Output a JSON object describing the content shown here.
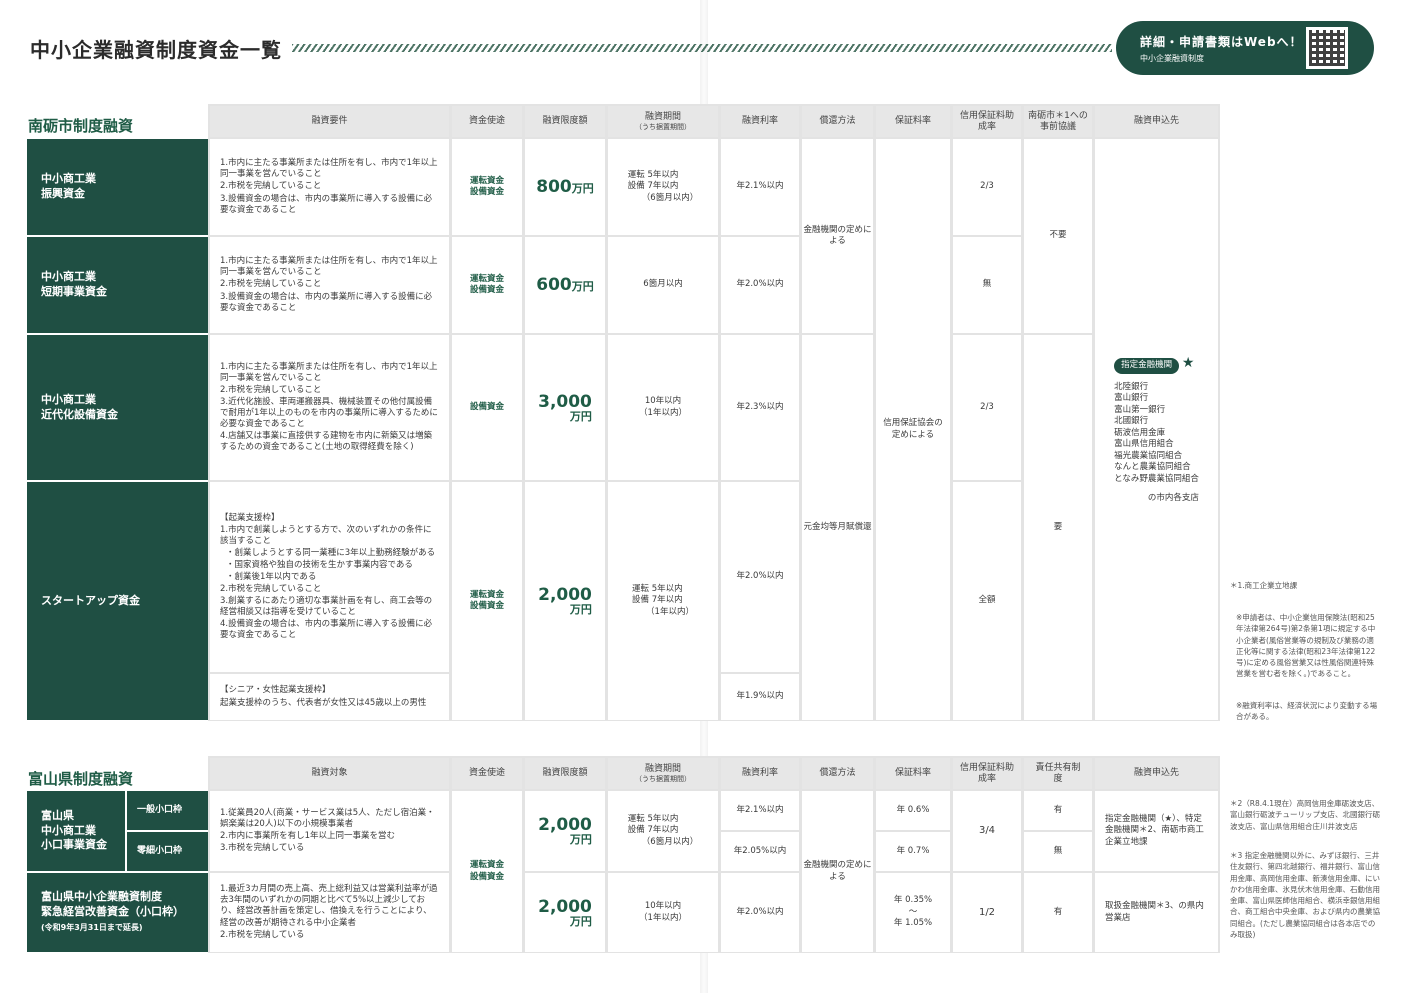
{
  "page_title": "中小企業融資制度資金一覧",
  "web": {
    "title": "詳細・申請書類はWebへ！",
    "subtitle": "中小企業融資制度"
  },
  "section1": {
    "title": "南砺市制度融資",
    "headers": {
      "req": "融資要件",
      "use": "資金使途",
      "limit": "融資限度額",
      "period": "融資期間",
      "period_sub": "（うち据置期間）",
      "rate": "融資利率",
      "repay": "償還方法",
      "fee": "保証料率",
      "subsidy": "信用保証料助成率",
      "consult": "南砺市＊1への事前協議",
      "apply": "融資申込先"
    },
    "rows": [
      {
        "name1": "中小商工業",
        "name2": "振興資金",
        "req": [
          "1.市内に主たる事業所または住所を有し、市内で1年以上同一事業を営んでいること",
          "2.市税を完納していること",
          "3.設備資金の場合は、市内の事業所に導入する設備に必要な資金であること"
        ],
        "use1": "運転資金",
        "use2": "設備資金",
        "limit_num": "800",
        "limit_unit": "万円",
        "period1": "運転 5年以内",
        "period2": "設備 7年以内",
        "period3": "（6箇月以内）",
        "rate": "年2.1%以内",
        "subsidy": "2/3"
      },
      {
        "name1": "中小商工業",
        "name2": "短期事業資金",
        "req": [
          "1.市内に主たる事業所または住所を有し、市内で1年以上同一事業を営んでいること",
          "2.市税を完納していること",
          "3.設備資金の場合は、市内の事業所に導入する設備に必要な資金であること"
        ],
        "use1": "運転資金",
        "use2": "設備資金",
        "limit_num": "600",
        "limit_unit": "万円",
        "period1": "6箇月以内",
        "rate": "年2.0%以内",
        "subsidy": "無"
      },
      {
        "name1": "中小商工業",
        "name2": "近代化設備資金",
        "req": [
          "1.市内に主たる事業所または住所を有し、市内で1年以上同一事業を営んでいること",
          "2.市税を完納していること",
          "3.近代化施設、車両運搬器具、機械装置その他付属設備で耐用が1年以上のものを市内の事業所に導入するために必要な資金であること",
          "4.店舗又は事業に直接供する建物を市内に新築又は増築するための資金であること(土地の取得経費を除く)"
        ],
        "use1": "設備資金",
        "limit_num": "3,000",
        "limit_unit": "万円",
        "period1": "10年以内",
        "period2": "（1年以内）",
        "rate": "年2.3%以内",
        "subsidy": "2/3"
      },
      {
        "name1": "スタートアップ資金",
        "req": [
          "【起業支援枠】",
          "1.市内で創業しようとする方で、次のいずれかの条件に該当すること",
          "・創業しようとする同一業種に3年以上勤務経験がある",
          "・国家資格や独自の技術を生かす事業内容である",
          "・創業後1年以内である",
          "2.市税を完納していること",
          "3.創業するにあたり適切な事業計画を有し、商工会等の経営相談又は指導を受けていること",
          "4.設備資金の場合は、市内の事業所に導入する設備に必要な資金であること"
        ],
        "req_sub1": "【シニア・女性起業支援枠】",
        "req_sub2": "起業支援枠のうち、代表者が女性又は45歳以上の男性",
        "use1": "運転資金",
        "use2": "設備資金",
        "limit_num": "2,000",
        "limit_unit": "万円",
        "period1": "運転 5年以内",
        "period2": "設備 7年以内",
        "period3": "（1年以内）",
        "rate": "年2.0%以内",
        "rate_sub": "年1.9%以内",
        "subsidy": "全額"
      }
    ],
    "repay_a": "金融機関の定めによる",
    "repay_b": "元金均等月賦償還",
    "fee": "信用保証協会の定めによる",
    "consult_a": "不要",
    "consult_b": "要",
    "apply_badge": "指定金融機関",
    "banks": [
      "北陸銀行",
      "富山銀行",
      "富山第一銀行",
      "北國銀行",
      "砺波信用金庫",
      "富山県信用組合",
      "福光農業協同組合",
      "なんと農業協同組合",
      "となみ野農業協同組合"
    ],
    "banks_tail": "の市内各支店"
  },
  "notes1": {
    "n1": "＊1.商工企業立地課",
    "n2": "※申請者は、中小企業信用保険法(昭和25年法律第264号)第2条第1項に規定する中小企業者(風俗営業等の規制及び業務の適正化等に関する法律(昭和23年法律第122号)に定める風俗営業又は性風俗関連特殊営業を営む者を除く。)であること。",
    "n3": "※融資利率は、経済状況により変動する場合がある。"
  },
  "section2": {
    "title": "富山県制度融資",
    "headers": {
      "req": "融資対象",
      "use": "資金使途",
      "limit": "融資限度額",
      "period": "融資期間",
      "period_sub": "（うち据置期間）",
      "rate": "融資利率",
      "repay": "償還方法",
      "fee": "保証料率",
      "subsidy": "信用保証料助成率",
      "share": "責任共有制度",
      "apply": "融資申込先"
    },
    "r1_name1": "富山県",
    "r1_name2": "中小商工業",
    "r1_name3": "小口事業資金",
    "r1_sub_a": "一般小口枠",
    "r1_sub_b": "零細小口枠",
    "r1_req": [
      "1.従業員20人(商業・サービス業は5人、ただし宿泊業・娯楽業は20人)以下の小規模事業者",
      "2.市内に事業所を有し1年以上同一事業を営む",
      "3.市税を完納している"
    ],
    "use1": "運転資金",
    "use2": "設備資金",
    "r1_limit_num": "2,000",
    "r1_limit_unit": "万円",
    "r1_period1": "運転 5年以内",
    "r1_period2": "設備 7年以内",
    "r1_period3": "（6箇月以内）",
    "r1_rate_a": "年2.1%以内",
    "r1_rate_b": "年2.05%以内",
    "repay": "金融機関の定めによる",
    "r1_fee_a": "年 0.6%",
    "r1_fee_b": "年 0.7%",
    "r1_subsidy": "3/4",
    "r1_share_a": "有",
    "r1_share_b": "無",
    "r1_apply": "指定金融機関（★）、特定金融機関＊2、南砺市商工企業立地課",
    "r2_name1": "富山県中小企業融資制度",
    "r2_name2": "緊急経営改善資金（小口枠）",
    "r2_name3": "(令和9年3月31日まで延長)",
    "r2_req": [
      "1.最近3カ月間の売上高、売上総利益又は営業利益率が過去3年間のいずれかの同期と比べて5%以上減少しており、経営改善計画を策定し、借換えを行うことにより、経営の改善が期待される中小企業者",
      "2.市税を完納している"
    ],
    "r2_limit_num": "2,000",
    "r2_limit_unit": "万円",
    "r2_period1": "10年以内",
    "r2_period2": "（1年以内）",
    "r2_rate": "年2.0%以内",
    "r2_fee1": "年 0.35%",
    "r2_fee2": "～",
    "r2_fee3": "年 1.05%",
    "r2_subsidy": "1/2",
    "r2_share": "有",
    "r2_apply": "取扱金融機関＊3、の県内営業店"
  },
  "notes2": {
    "n1": "＊2（R8.4.1現在）高岡信用金庫砺波支店、富山銀行砺波チューリップ支店、北國銀行砺波支店、富山県信用組合庄川井波支店",
    "n2": "＊3 指定金融機関以外に、みずほ銀行、三井住友銀行、第四北越銀行、福井銀行、富山信用金庫、高岡信用金庫、新湊信用金庫、にいかわ信用金庫、氷見伏木信用金庫、石動信用金庫、富山県医師信用組合、横浜幸銀信用組合、商工組合中央金庫、および県内の農業協同組合。(ただし農業協同組合は各本店でのみ取扱)"
  }
}
